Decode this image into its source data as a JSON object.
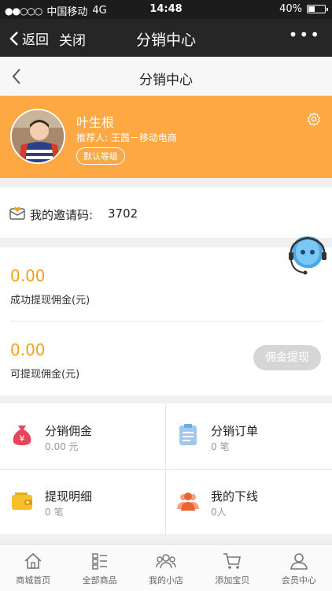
{
  "status_bar": {
    "signal": "●●○○○",
    "carrier": "中国移动",
    "network": "4G",
    "time": "14:48",
    "battery": "40%",
    "battery_level": 0.4
  },
  "nav": {
    "back_label": "返回",
    "close_label": "关闭",
    "title": "分销中心",
    "more": "•••"
  },
  "page_header": {
    "title": "分销中心"
  },
  "profile": {
    "name": "叶生根",
    "referrer": "推荐人: 王茜－移动电商",
    "level": "默认等级"
  },
  "invite": {
    "label": "我的邀请码:",
    "code": "3702"
  },
  "wallet": {
    "withdrawn_amount": "0.00",
    "withdrawn_label": "成功提现佣金(元)",
    "available_amount": "0.00",
    "available_label": "可提现佣金(元)",
    "withdraw_button": "佣金提现"
  },
  "grid": [
    {
      "title": "分销佣金",
      "sub": "0.00 元",
      "icon": "money-bag-icon"
    },
    {
      "title": "分销订单",
      "sub": "0 笔",
      "icon": "order-list-icon"
    },
    {
      "title": "提现明细",
      "sub": "0 笔",
      "icon": "wallet-icon"
    },
    {
      "title": "我的下线",
      "sub": "0人",
      "icon": "team-icon"
    }
  ],
  "tabs": [
    {
      "label": "商城首页",
      "icon": "home-icon"
    },
    {
      "label": "全部商品",
      "icon": "category-icon"
    },
    {
      "label": "我的小店",
      "icon": "shop-icon"
    },
    {
      "label": "添加宝贝",
      "icon": "cart-icon"
    },
    {
      "label": "会员中心",
      "icon": "member-icon"
    }
  ],
  "colors": {
    "accent": "#fea844",
    "amount": "#f5a01a",
    "nav_bg": "#262626"
  }
}
